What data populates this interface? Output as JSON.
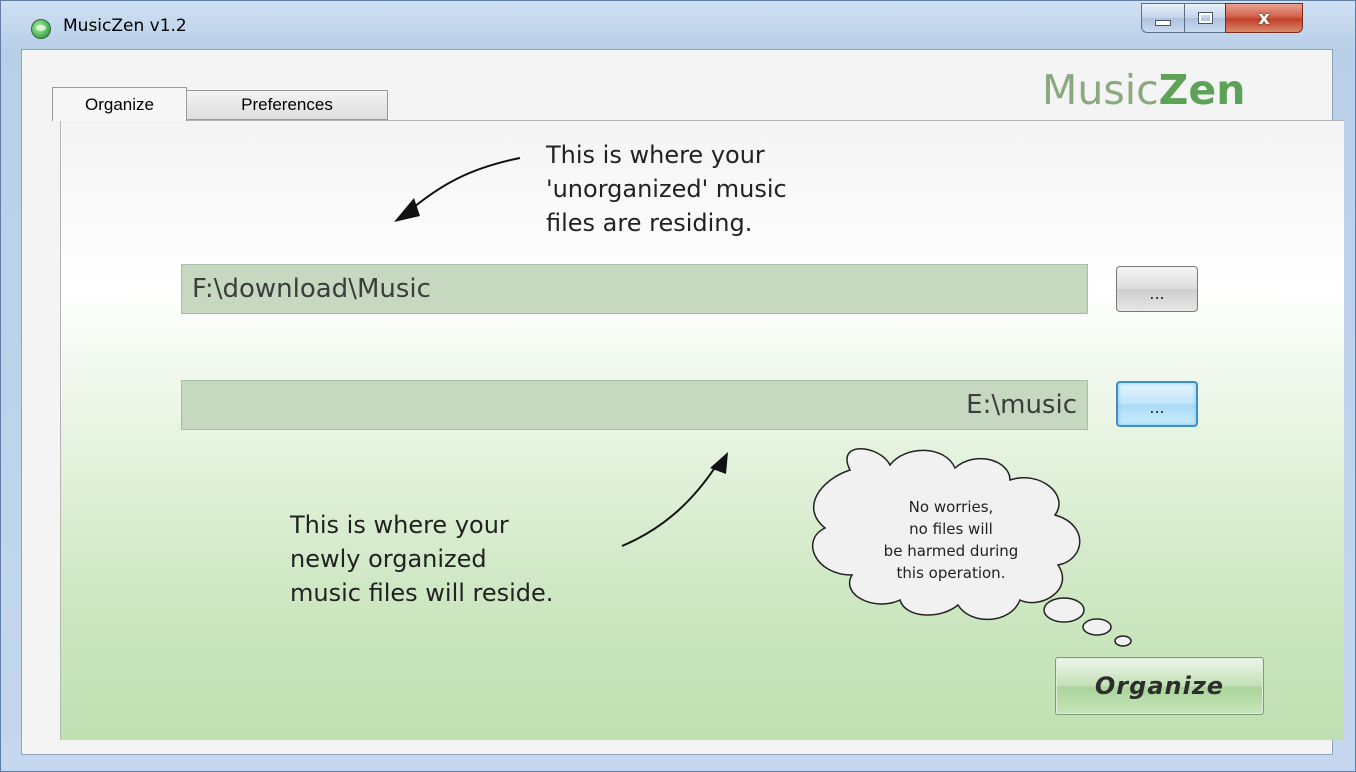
{
  "window": {
    "title": "MusicZen v1.2",
    "controls": {
      "minimize_icon": "minimize-icon",
      "maximize_icon": "maximize-icon",
      "close_glyph": "x"
    }
  },
  "logo": {
    "part1": "Music",
    "part2": "Zen"
  },
  "tabs": [
    {
      "label": "Organize",
      "active": true
    },
    {
      "label": "Preferences",
      "active": false
    }
  ],
  "organize": {
    "source_note": [
      "This is where your",
      "'unorganized' music",
      "files are residing."
    ],
    "source_path": "F:\\download\\Music",
    "source_browse_label": "...",
    "destination_path": "E:\\music",
    "destination_browse_label": "...",
    "destination_note": [
      "This is where your",
      "newly organized",
      "music files will reside."
    ],
    "cloud_note": [
      "No worries,",
      "no files will",
      "be harmed during",
      "this operation."
    ],
    "organize_button_label": "Organize"
  },
  "colors": {
    "field_bg": "#c6d8c0",
    "logo_light": "#8aa97f",
    "logo_dark": "#5da257",
    "panel_bottom": "#bfe0b1",
    "focused_button_border": "#3c8fc7"
  }
}
